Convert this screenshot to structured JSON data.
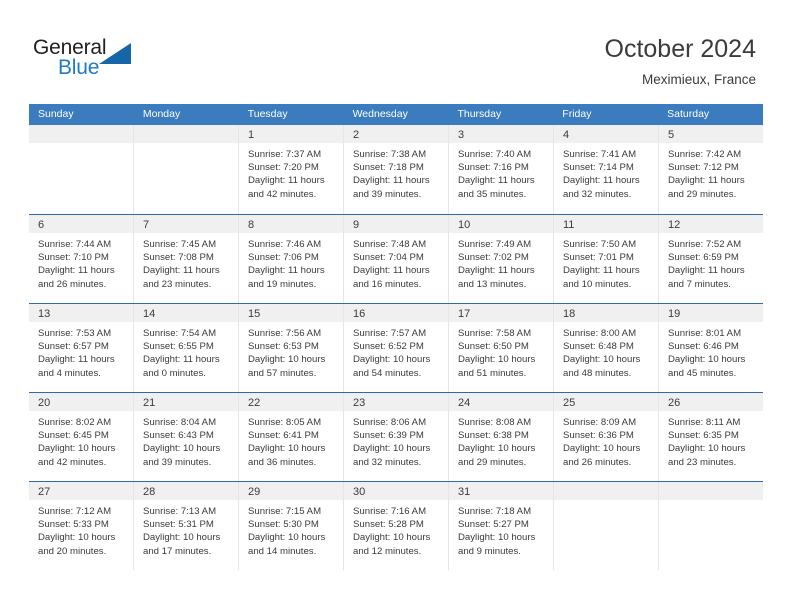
{
  "brand": {
    "name_part1": "General",
    "name_part2": "Blue",
    "triangle_color": "#1565a8",
    "blue_color": "#1e7bc4"
  },
  "header": {
    "title": "October 2024",
    "subtitle": "Meximieux, France"
  },
  "theme": {
    "header_band": "#3a7cbe",
    "row_divider": "#2b6ca8",
    "day_band": "#f0f0f0",
    "text": "#3b3b3b"
  },
  "weekdays": [
    "Sunday",
    "Monday",
    "Tuesday",
    "Wednesday",
    "Thursday",
    "Friday",
    "Saturday"
  ],
  "weeks": [
    [
      {
        "empty": true
      },
      {
        "empty": true
      },
      {
        "day": "1",
        "sunrise": "Sunrise: 7:37 AM",
        "sunset": "Sunset: 7:20 PM",
        "daylight": "Daylight: 11 hours and 42 minutes."
      },
      {
        "day": "2",
        "sunrise": "Sunrise: 7:38 AM",
        "sunset": "Sunset: 7:18 PM",
        "daylight": "Daylight: 11 hours and 39 minutes."
      },
      {
        "day": "3",
        "sunrise": "Sunrise: 7:40 AM",
        "sunset": "Sunset: 7:16 PM",
        "daylight": "Daylight: 11 hours and 35 minutes."
      },
      {
        "day": "4",
        "sunrise": "Sunrise: 7:41 AM",
        "sunset": "Sunset: 7:14 PM",
        "daylight": "Daylight: 11 hours and 32 minutes."
      },
      {
        "day": "5",
        "sunrise": "Sunrise: 7:42 AM",
        "sunset": "Sunset: 7:12 PM",
        "daylight": "Daylight: 11 hours and 29 minutes."
      }
    ],
    [
      {
        "day": "6",
        "sunrise": "Sunrise: 7:44 AM",
        "sunset": "Sunset: 7:10 PM",
        "daylight": "Daylight: 11 hours and 26 minutes."
      },
      {
        "day": "7",
        "sunrise": "Sunrise: 7:45 AM",
        "sunset": "Sunset: 7:08 PM",
        "daylight": "Daylight: 11 hours and 23 minutes."
      },
      {
        "day": "8",
        "sunrise": "Sunrise: 7:46 AM",
        "sunset": "Sunset: 7:06 PM",
        "daylight": "Daylight: 11 hours and 19 minutes."
      },
      {
        "day": "9",
        "sunrise": "Sunrise: 7:48 AM",
        "sunset": "Sunset: 7:04 PM",
        "daylight": "Daylight: 11 hours and 16 minutes."
      },
      {
        "day": "10",
        "sunrise": "Sunrise: 7:49 AM",
        "sunset": "Sunset: 7:02 PM",
        "daylight": "Daylight: 11 hours and 13 minutes."
      },
      {
        "day": "11",
        "sunrise": "Sunrise: 7:50 AM",
        "sunset": "Sunset: 7:01 PM",
        "daylight": "Daylight: 11 hours and 10 minutes."
      },
      {
        "day": "12",
        "sunrise": "Sunrise: 7:52 AM",
        "sunset": "Sunset: 6:59 PM",
        "daylight": "Daylight: 11 hours and 7 minutes."
      }
    ],
    [
      {
        "day": "13",
        "sunrise": "Sunrise: 7:53 AM",
        "sunset": "Sunset: 6:57 PM",
        "daylight": "Daylight: 11 hours and 4 minutes."
      },
      {
        "day": "14",
        "sunrise": "Sunrise: 7:54 AM",
        "sunset": "Sunset: 6:55 PM",
        "daylight": "Daylight: 11 hours and 0 minutes."
      },
      {
        "day": "15",
        "sunrise": "Sunrise: 7:56 AM",
        "sunset": "Sunset: 6:53 PM",
        "daylight": "Daylight: 10 hours and 57 minutes."
      },
      {
        "day": "16",
        "sunrise": "Sunrise: 7:57 AM",
        "sunset": "Sunset: 6:52 PM",
        "daylight": "Daylight: 10 hours and 54 minutes."
      },
      {
        "day": "17",
        "sunrise": "Sunrise: 7:58 AM",
        "sunset": "Sunset: 6:50 PM",
        "daylight": "Daylight: 10 hours and 51 minutes."
      },
      {
        "day": "18",
        "sunrise": "Sunrise: 8:00 AM",
        "sunset": "Sunset: 6:48 PM",
        "daylight": "Daylight: 10 hours and 48 minutes."
      },
      {
        "day": "19",
        "sunrise": "Sunrise: 8:01 AM",
        "sunset": "Sunset: 6:46 PM",
        "daylight": "Daylight: 10 hours and 45 minutes."
      }
    ],
    [
      {
        "day": "20",
        "sunrise": "Sunrise: 8:02 AM",
        "sunset": "Sunset: 6:45 PM",
        "daylight": "Daylight: 10 hours and 42 minutes."
      },
      {
        "day": "21",
        "sunrise": "Sunrise: 8:04 AM",
        "sunset": "Sunset: 6:43 PM",
        "daylight": "Daylight: 10 hours and 39 minutes."
      },
      {
        "day": "22",
        "sunrise": "Sunrise: 8:05 AM",
        "sunset": "Sunset: 6:41 PM",
        "daylight": "Daylight: 10 hours and 36 minutes."
      },
      {
        "day": "23",
        "sunrise": "Sunrise: 8:06 AM",
        "sunset": "Sunset: 6:39 PM",
        "daylight": "Daylight: 10 hours and 32 minutes."
      },
      {
        "day": "24",
        "sunrise": "Sunrise: 8:08 AM",
        "sunset": "Sunset: 6:38 PM",
        "daylight": "Daylight: 10 hours and 29 minutes."
      },
      {
        "day": "25",
        "sunrise": "Sunrise: 8:09 AM",
        "sunset": "Sunset: 6:36 PM",
        "daylight": "Daylight: 10 hours and 26 minutes."
      },
      {
        "day": "26",
        "sunrise": "Sunrise: 8:11 AM",
        "sunset": "Sunset: 6:35 PM",
        "daylight": "Daylight: 10 hours and 23 minutes."
      }
    ],
    [
      {
        "day": "27",
        "sunrise": "Sunrise: 7:12 AM",
        "sunset": "Sunset: 5:33 PM",
        "daylight": "Daylight: 10 hours and 20 minutes."
      },
      {
        "day": "28",
        "sunrise": "Sunrise: 7:13 AM",
        "sunset": "Sunset: 5:31 PM",
        "daylight": "Daylight: 10 hours and 17 minutes."
      },
      {
        "day": "29",
        "sunrise": "Sunrise: 7:15 AM",
        "sunset": "Sunset: 5:30 PM",
        "daylight": "Daylight: 10 hours and 14 minutes."
      },
      {
        "day": "30",
        "sunrise": "Sunrise: 7:16 AM",
        "sunset": "Sunset: 5:28 PM",
        "daylight": "Daylight: 10 hours and 12 minutes."
      },
      {
        "day": "31",
        "sunrise": "Sunrise: 7:18 AM",
        "sunset": "Sunset: 5:27 PM",
        "daylight": "Daylight: 10 hours and 9 minutes."
      },
      {
        "empty": true
      },
      {
        "empty": true
      }
    ]
  ]
}
